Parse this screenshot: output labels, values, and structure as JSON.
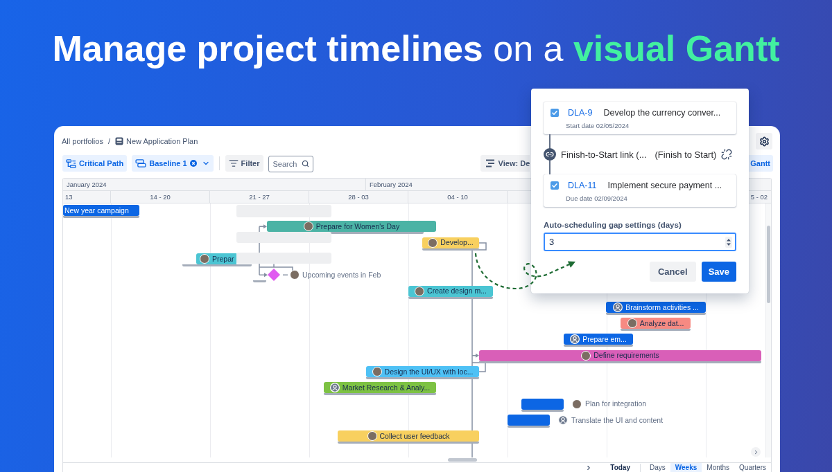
{
  "headline": {
    "parts": [
      {
        "text": "Manage project timelines",
        "kind": "strong"
      },
      {
        "text": "on a",
        "kind": "light"
      },
      {
        "text": "visual Gantt",
        "kind": "accent"
      }
    ]
  },
  "breadcrumb": {
    "items": [
      {
        "label": "All portfolios",
        "kind": "link"
      },
      {
        "label": "New Application Plan",
        "kind": "plan"
      }
    ],
    "separator": "/"
  },
  "toolbar": {
    "buttons": [
      {
        "kind": "critical-path",
        "label": "Critical Path",
        "on": true
      },
      {
        "kind": "baseline",
        "label": "Baseline 1",
        "on": true
      },
      {
        "kind": "filter",
        "label": "Filter",
        "on": false
      }
    ],
    "search": {
      "placeholder": "Search"
    },
    "view": {
      "label": "View: De"
    },
    "gantt": {
      "label": "Gantt",
      "on": true
    }
  },
  "timeline": {
    "months": [
      "January 2024",
      "February 2024"
    ],
    "weeks": [
      "13",
      "14 - 20",
      "21 - 27",
      "28 - 03",
      "04 - 10",
      "5 - 02"
    ]
  },
  "tasks": [
    {
      "kind": "bar",
      "label": "New year campaign",
      "color": "#0c66e4"
    },
    {
      "kind": "bar",
      "label": "Prepare for Women's Day",
      "color": "#4bb3a5",
      "avatar": {
        "kind": "photo"
      }
    },
    {
      "kind": "bar",
      "label": "Develop...",
      "color": "#f8d05f",
      "avatar": {
        "kind": "photo"
      }
    },
    {
      "kind": "bar",
      "label": "Prepar",
      "color": "#4bc5d3",
      "avatar": {
        "kind": "photo"
      }
    },
    {
      "kind": "milestone",
      "label": "Upcoming events in Feb",
      "color": "#e05bf0",
      "avatar": {
        "kind": "photo"
      }
    },
    {
      "kind": "bar",
      "label": "Create design m...",
      "color": "#4bc5d3",
      "avatar": {
        "kind": "photo"
      }
    },
    {
      "kind": "bar",
      "label": "Brainstorm activities ...",
      "color": "#0c66e4",
      "avatar": {
        "kind": "default"
      }
    },
    {
      "kind": "bar",
      "label": "Analyze dat...",
      "color": "#f78a82",
      "avatar": {
        "kind": "photo"
      }
    },
    {
      "kind": "bar",
      "label": "Prepare em...",
      "color": "#0c66e4",
      "avatar": {
        "kind": "default"
      }
    },
    {
      "kind": "bar",
      "label": "Define requirements",
      "color": "#d95fb8",
      "avatar": {
        "kind": "photo"
      }
    },
    {
      "kind": "bar",
      "label": "Design the UI/UX with loc...",
      "color": "#4ec1f5",
      "avatar": {
        "kind": "photo"
      }
    },
    {
      "kind": "bar",
      "label": "Market Research & Analy...",
      "color": "#7dc243",
      "avatar": {
        "kind": "default"
      }
    },
    {
      "kind": "outside",
      "label": "Plan for integration",
      "color": "#0c66e4",
      "avatar": {
        "kind": "photo"
      }
    },
    {
      "kind": "outside",
      "label": "Translate the UI and content",
      "color": "#0c66e4",
      "avatar": {
        "kind": "default"
      }
    },
    {
      "kind": "bar",
      "label": "Collect user feedback",
      "color": "#f8d05f",
      "avatar": {
        "kind": "photo"
      }
    }
  ],
  "link_dialog": {
    "tasks": [
      {
        "checked": true,
        "key": "DLA-9",
        "title": "Develop the currency conver...",
        "date": "Start date 02/05/2024"
      },
      {
        "checked": true,
        "key": "DLA-11",
        "title": "Implement secure payment ...",
        "date": "Due date 02/09/2024"
      }
    ],
    "link": {
      "name": "Finish-to-Start link (...",
      "type": "(Finish to Start)"
    },
    "gap": {
      "label": "Auto-scheduling gap settings (days)",
      "value": "3"
    },
    "buttons": [
      {
        "kind": "secondary",
        "label": "Cancel"
      },
      {
        "kind": "primary",
        "label": "Save"
      }
    ]
  },
  "footer": {
    "today": "Today",
    "scales": [
      {
        "label": "Days",
        "selected": false
      },
      {
        "label": "Weeks",
        "selected": true
      },
      {
        "label": "Months",
        "selected": false
      },
      {
        "label": "Quarters",
        "selected": false
      }
    ]
  }
}
